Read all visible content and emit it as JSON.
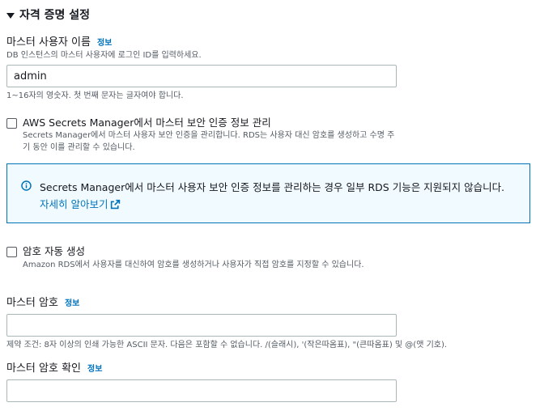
{
  "section": {
    "title": "자격 증명 설정"
  },
  "username": {
    "label": "마스터 사용자 이름",
    "info": "정보",
    "description": "DB 인스턴스의 마스터 사용자에 로그인 ID를 입력하세요.",
    "value": "admin",
    "constraint": "1~16자의 영숫자. 첫 번째 문자는 글자여야 합니다."
  },
  "secrets_manager": {
    "checked": false,
    "label": "AWS Secrets Manager에서 마스터 보안 인증 정보 관리",
    "description": "Secrets Manager에서 마스터 사용자 보안 인증을 관리합니다. RDS는 사용자 대신 암호를 생성하고 수명 주기 동안 이를 관리할 수 있습니다."
  },
  "alert": {
    "text": "Secrets Manager에서 마스터 사용자 보안 인증 정보를 관리하는 경우 일부 RDS 기능은 지원되지 않습니다.",
    "link": "자세히 알아보기"
  },
  "auto_password": {
    "checked": false,
    "label": "암호 자동 생성",
    "description": "Amazon RDS에서 사용자를 대신하여 암호를 생성하거나 사용자가 직접 암호를 지정할 수 있습니다."
  },
  "master_password": {
    "label": "마스터 암호",
    "info": "정보",
    "value": "",
    "constraint": "제약 조건: 8자 이상의 인쇄 가능한 ASCII 문자. 다음은 포함할 수 없습니다. /(슬래시), '(작은따옴표), \"(큰따옴표) 및 @(앳 기호)."
  },
  "confirm_password": {
    "label": "마스터 암호 확인",
    "info": "정보",
    "value": ""
  },
  "colors": {
    "link": "#0073bb",
    "alert_border": "#0073bb",
    "alert_bg": "#f1faff"
  }
}
